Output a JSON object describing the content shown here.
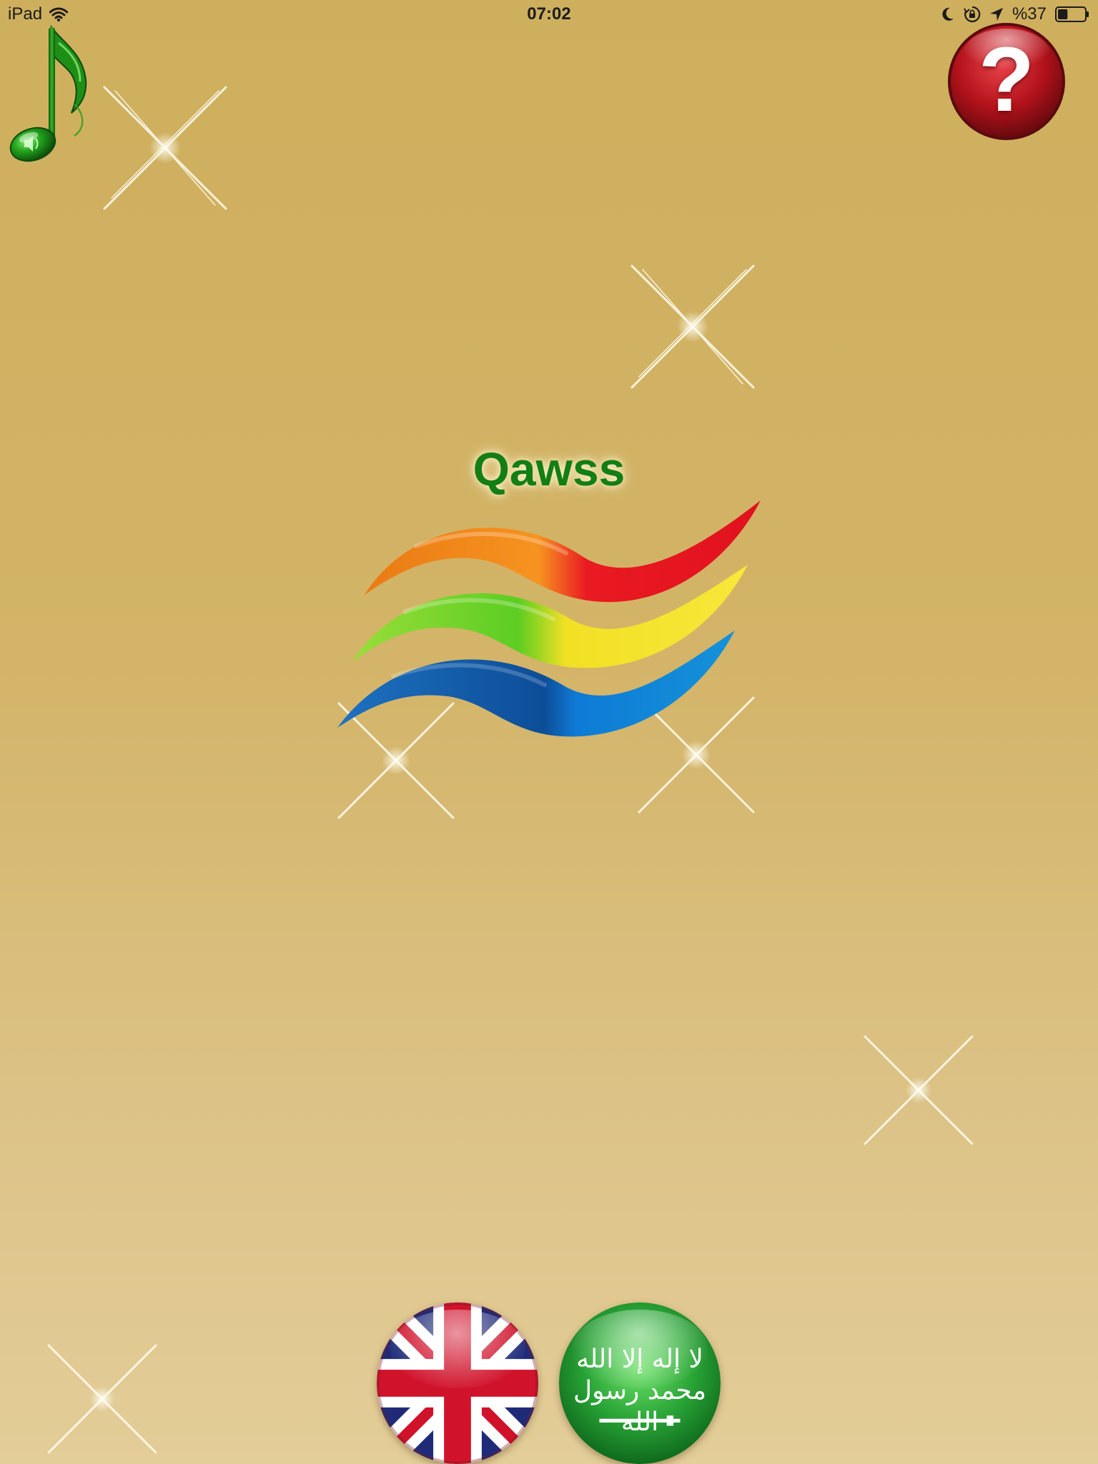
{
  "status_bar": {
    "device": "iPad",
    "time": "07:02",
    "battery": "%37",
    "battery_level": 0.37
  },
  "icons": {
    "wifi": "wifi-icon",
    "moon": "moon-icon",
    "rotation_lock": "rotation-lock-icon",
    "location": "location-arrow-icon",
    "battery": "battery-icon",
    "music": "music-note-sound-icon",
    "help": "question-mark-icon",
    "logo": "rainbow-waves-logo"
  },
  "help_button": {
    "symbol": "?"
  },
  "app": {
    "title": "Qawss"
  },
  "languages": [
    {
      "name": "English",
      "flag": "uk-flag"
    },
    {
      "name": "Arabic",
      "flag": "saudi-flag",
      "flag_text": "لا إله إلا الله محمد رسول الله"
    }
  ],
  "colors": {
    "background_top": "#ceaf5d",
    "background_bottom": "#e3cd98",
    "title_green": "#127e14",
    "help_red": "#c0161f",
    "logo_orange": "#f28a1e",
    "logo_red": "#e8141f",
    "logo_green": "#76d42c",
    "logo_yellow": "#f6e22a",
    "logo_blue": "#1468b0",
    "logo_light_blue": "#1a8ee0"
  }
}
